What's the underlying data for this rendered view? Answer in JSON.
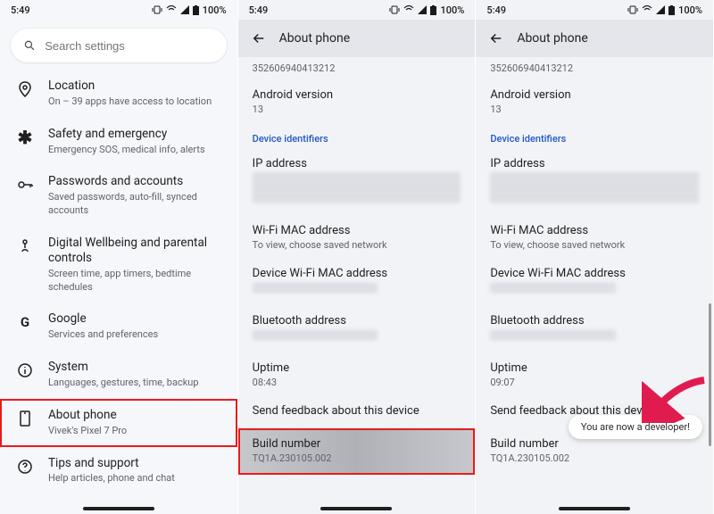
{
  "status": {
    "time": "5:49",
    "battery": "100%"
  },
  "panel1": {
    "search_placeholder": "Search settings",
    "items": [
      {
        "icon": "location",
        "title": "Location",
        "sub": "On – 39 apps have access to location"
      },
      {
        "icon": "asterisk",
        "title": "Safety and emergency",
        "sub": "Emergency SOS, medical info, alerts"
      },
      {
        "icon": "key",
        "title": "Passwords and accounts",
        "sub": "Saved passwords, auto-fill, synced accounts"
      },
      {
        "icon": "wellbeing",
        "title": "Digital Wellbeing and parental controls",
        "sub": "Screen time, app timers, bedtime schedules"
      },
      {
        "icon": "google",
        "title": "Google",
        "sub": "Services and preferences"
      },
      {
        "icon": "info",
        "title": "System",
        "sub": "Languages, gestures, time, backup"
      },
      {
        "icon": "phone",
        "title": "About phone",
        "sub": "Vivek's Pixel 7 Pro"
      },
      {
        "icon": "help",
        "title": "Tips and support",
        "sub": "Help articles, phone and chat"
      }
    ]
  },
  "about": {
    "header": "About phone",
    "scroll_residue": "352606940413212",
    "android_version_label": "Android version",
    "android_version_value": "13",
    "device_identifiers_label": "Device identifiers",
    "ip_label": "IP address",
    "wifi_mac_label": "Wi-Fi MAC address",
    "wifi_mac_sub": "To view, choose saved network",
    "device_wifi_mac_label": "Device Wi-Fi MAC address",
    "bt_label": "Bluetooth address",
    "uptime_label": "Uptime",
    "uptime_value_p2": "08:43",
    "uptime_value_p3": "09:07",
    "feedback_label": "Send feedback about this device",
    "build_label": "Build number",
    "build_value": "TQ1A.230105.002"
  },
  "toast": "You are now a developer!"
}
